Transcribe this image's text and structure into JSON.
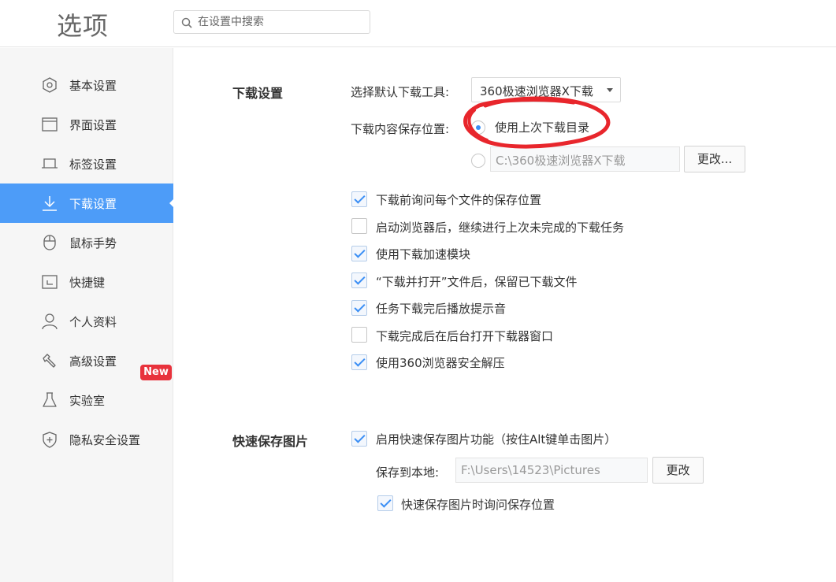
{
  "header": {
    "title": "选项",
    "search_placeholder": "在设置中搜索"
  },
  "sidebar": {
    "items": [
      {
        "label": "基本设置",
        "icon": "hexagon-icon"
      },
      {
        "label": "界面设置",
        "icon": "window-icon"
      },
      {
        "label": "标签设置",
        "icon": "tab-icon"
      },
      {
        "label": "下载设置",
        "icon": "download-icon",
        "active": true
      },
      {
        "label": "鼠标手势",
        "icon": "mouse-icon"
      },
      {
        "label": "快捷键",
        "icon": "shortcut-icon"
      },
      {
        "label": "个人资料",
        "icon": "person-icon"
      },
      {
        "label": "高级设置",
        "icon": "wrench-icon"
      },
      {
        "label": "实验室",
        "icon": "flask-icon"
      },
      {
        "label": "隐私安全设置",
        "icon": "shield-icon"
      }
    ],
    "new_badge": "New"
  },
  "download": {
    "section_title": "下载设置",
    "tool_label": "选择默认下载工具:",
    "tool_value": "360极速浏览器X下载",
    "location_label": "下载内容保存位置:",
    "option_last_dir": "使用上次下载目录",
    "path_value": "C:\\360极速浏览器X下载",
    "change_button": "更改...",
    "checkboxes": [
      {
        "label": "下载前询问每个文件的保存位置",
        "checked": true
      },
      {
        "label": "启动浏览器后，继续进行上次未完成的下载任务",
        "checked": false
      },
      {
        "label": "使用下载加速模块",
        "checked": true
      },
      {
        "label": "“下载并打开”文件后，保留已下载文件",
        "checked": true
      },
      {
        "label": "任务下载完后播放提示音",
        "checked": true
      },
      {
        "label": "下载完成后在后台打开下载器窗口",
        "checked": false
      },
      {
        "label": "使用360浏览器安全解压",
        "checked": true
      }
    ]
  },
  "quick_save": {
    "section_title": "快速保存图片",
    "enable_label": "启用快速保存图片功能（按住Alt键单击图片）",
    "save_local_label": "保存到本地:",
    "path_value": "F:\\Users\\14523\\Pictures",
    "change_button": "更改",
    "ask_label": "快速保存图片时询问保存位置"
  },
  "colors": {
    "accent": "#4d9cf8",
    "annotation": "#e8262c",
    "badge": "#e8323c"
  }
}
